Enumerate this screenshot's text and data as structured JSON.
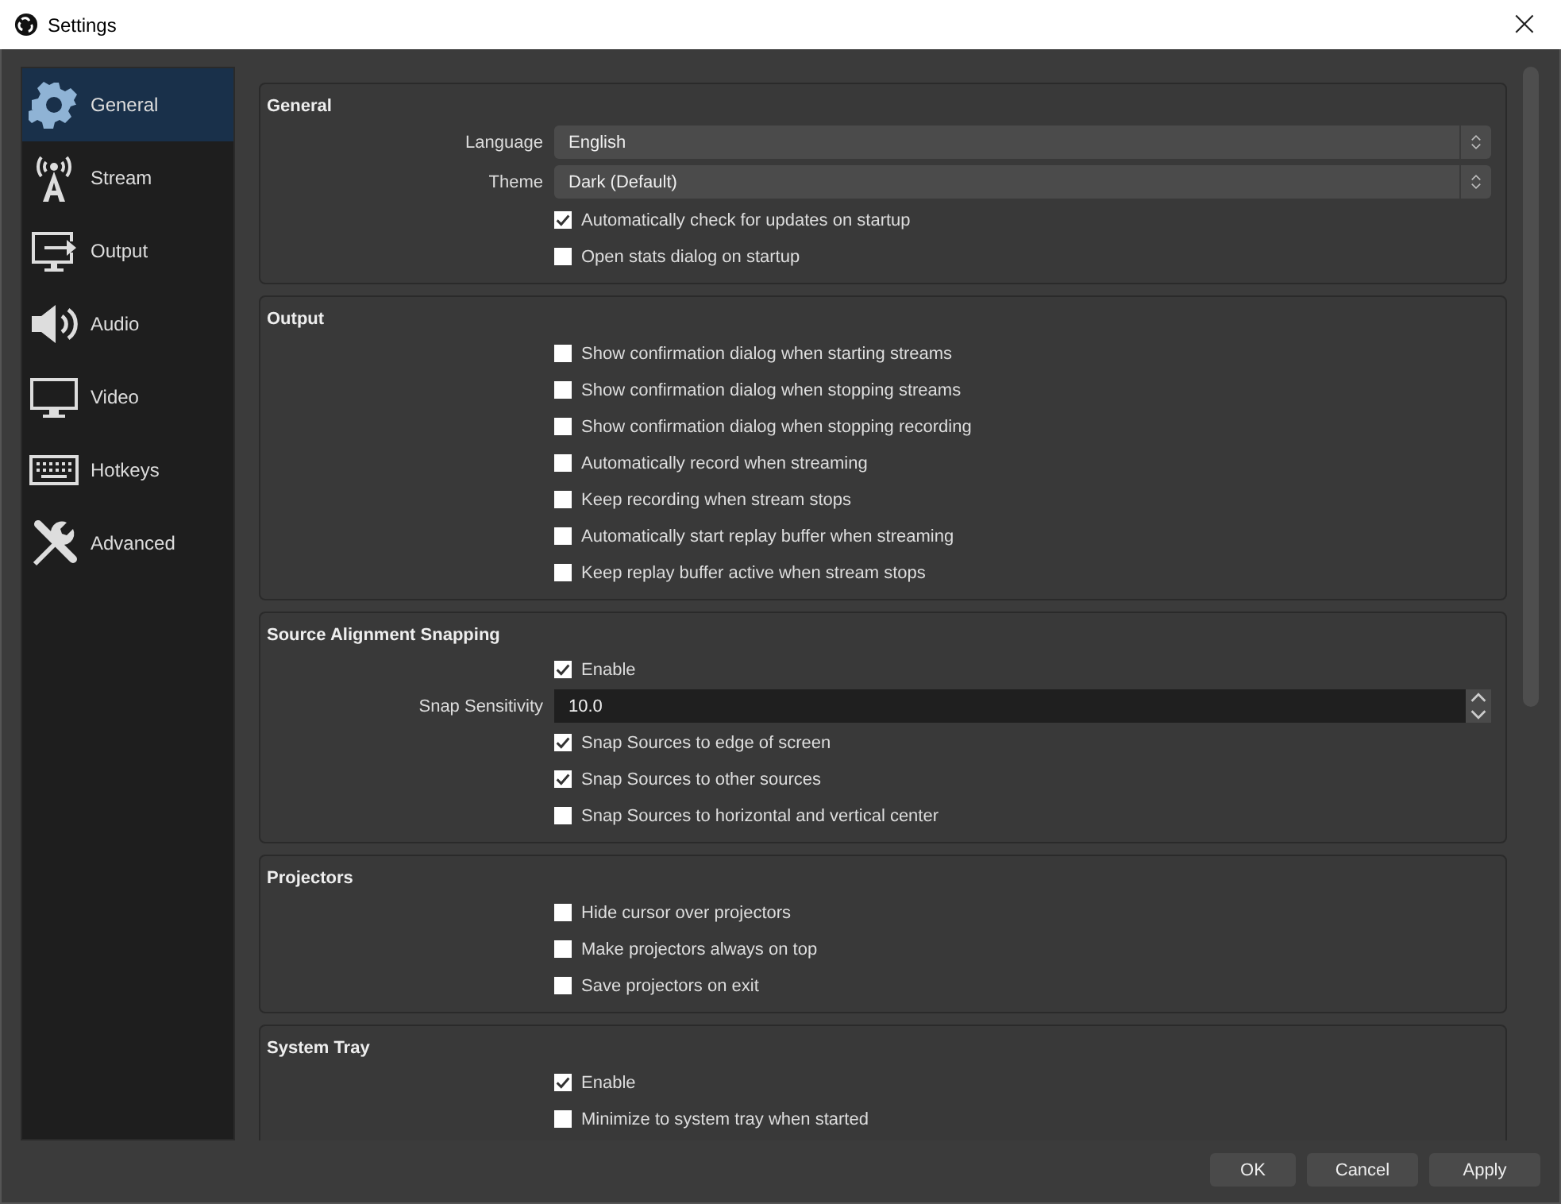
{
  "window": {
    "title": "Settings",
    "close": "×"
  },
  "sidebar": {
    "items": [
      {
        "label": "General",
        "selected": true
      },
      {
        "label": "Stream",
        "selected": false
      },
      {
        "label": "Output",
        "selected": false
      },
      {
        "label": "Audio",
        "selected": false
      },
      {
        "label": "Video",
        "selected": false
      },
      {
        "label": "Hotkeys",
        "selected": false
      },
      {
        "label": "Advanced",
        "selected": false
      }
    ]
  },
  "sections": [
    {
      "title": "General",
      "rows": [
        {
          "kind": "select",
          "label": "Language",
          "value": "English"
        },
        {
          "kind": "select",
          "label": "Theme",
          "value": "Dark (Default)"
        },
        {
          "kind": "check",
          "label": "Automatically check for updates on startup",
          "checked": true
        },
        {
          "kind": "check",
          "label": "Open stats dialog on startup",
          "checked": false
        }
      ]
    },
    {
      "title": "Output",
      "rows": [
        {
          "kind": "check",
          "label": "Show confirmation dialog when starting streams",
          "checked": false
        },
        {
          "kind": "check",
          "label": "Show confirmation dialog when stopping streams",
          "checked": false
        },
        {
          "kind": "check",
          "label": "Show confirmation dialog when stopping recording",
          "checked": false
        },
        {
          "kind": "check",
          "label": "Automatically record when streaming",
          "checked": false
        },
        {
          "kind": "check",
          "label": "Keep recording when stream stops",
          "checked": false
        },
        {
          "kind": "check",
          "label": "Automatically start replay buffer when streaming",
          "checked": false
        },
        {
          "kind": "check",
          "label": "Keep replay buffer active when stream stops",
          "checked": false
        }
      ]
    },
    {
      "title": "Source Alignment Snapping",
      "rows": [
        {
          "kind": "check",
          "label": "Enable",
          "checked": true
        },
        {
          "kind": "spin",
          "label": "Snap Sensitivity",
          "value": "10.0"
        },
        {
          "kind": "check",
          "label": "Snap Sources to edge of screen",
          "checked": true
        },
        {
          "kind": "check",
          "label": "Snap Sources to other sources",
          "checked": true
        },
        {
          "kind": "check",
          "label": "Snap Sources to horizontal and vertical center",
          "checked": false
        }
      ]
    },
    {
      "title": "Projectors",
      "rows": [
        {
          "kind": "check",
          "label": "Hide cursor over projectors",
          "checked": false
        },
        {
          "kind": "check",
          "label": "Make projectors always on top",
          "checked": false
        },
        {
          "kind": "check",
          "label": "Save projectors on exit",
          "checked": false
        }
      ]
    },
    {
      "title": "System Tray",
      "rows": [
        {
          "kind": "check",
          "label": "Enable",
          "checked": true
        },
        {
          "kind": "check",
          "label": "Minimize to system tray when started",
          "checked": false
        }
      ]
    }
  ],
  "buttons": [
    "OK",
    "Cancel",
    "Apply"
  ]
}
